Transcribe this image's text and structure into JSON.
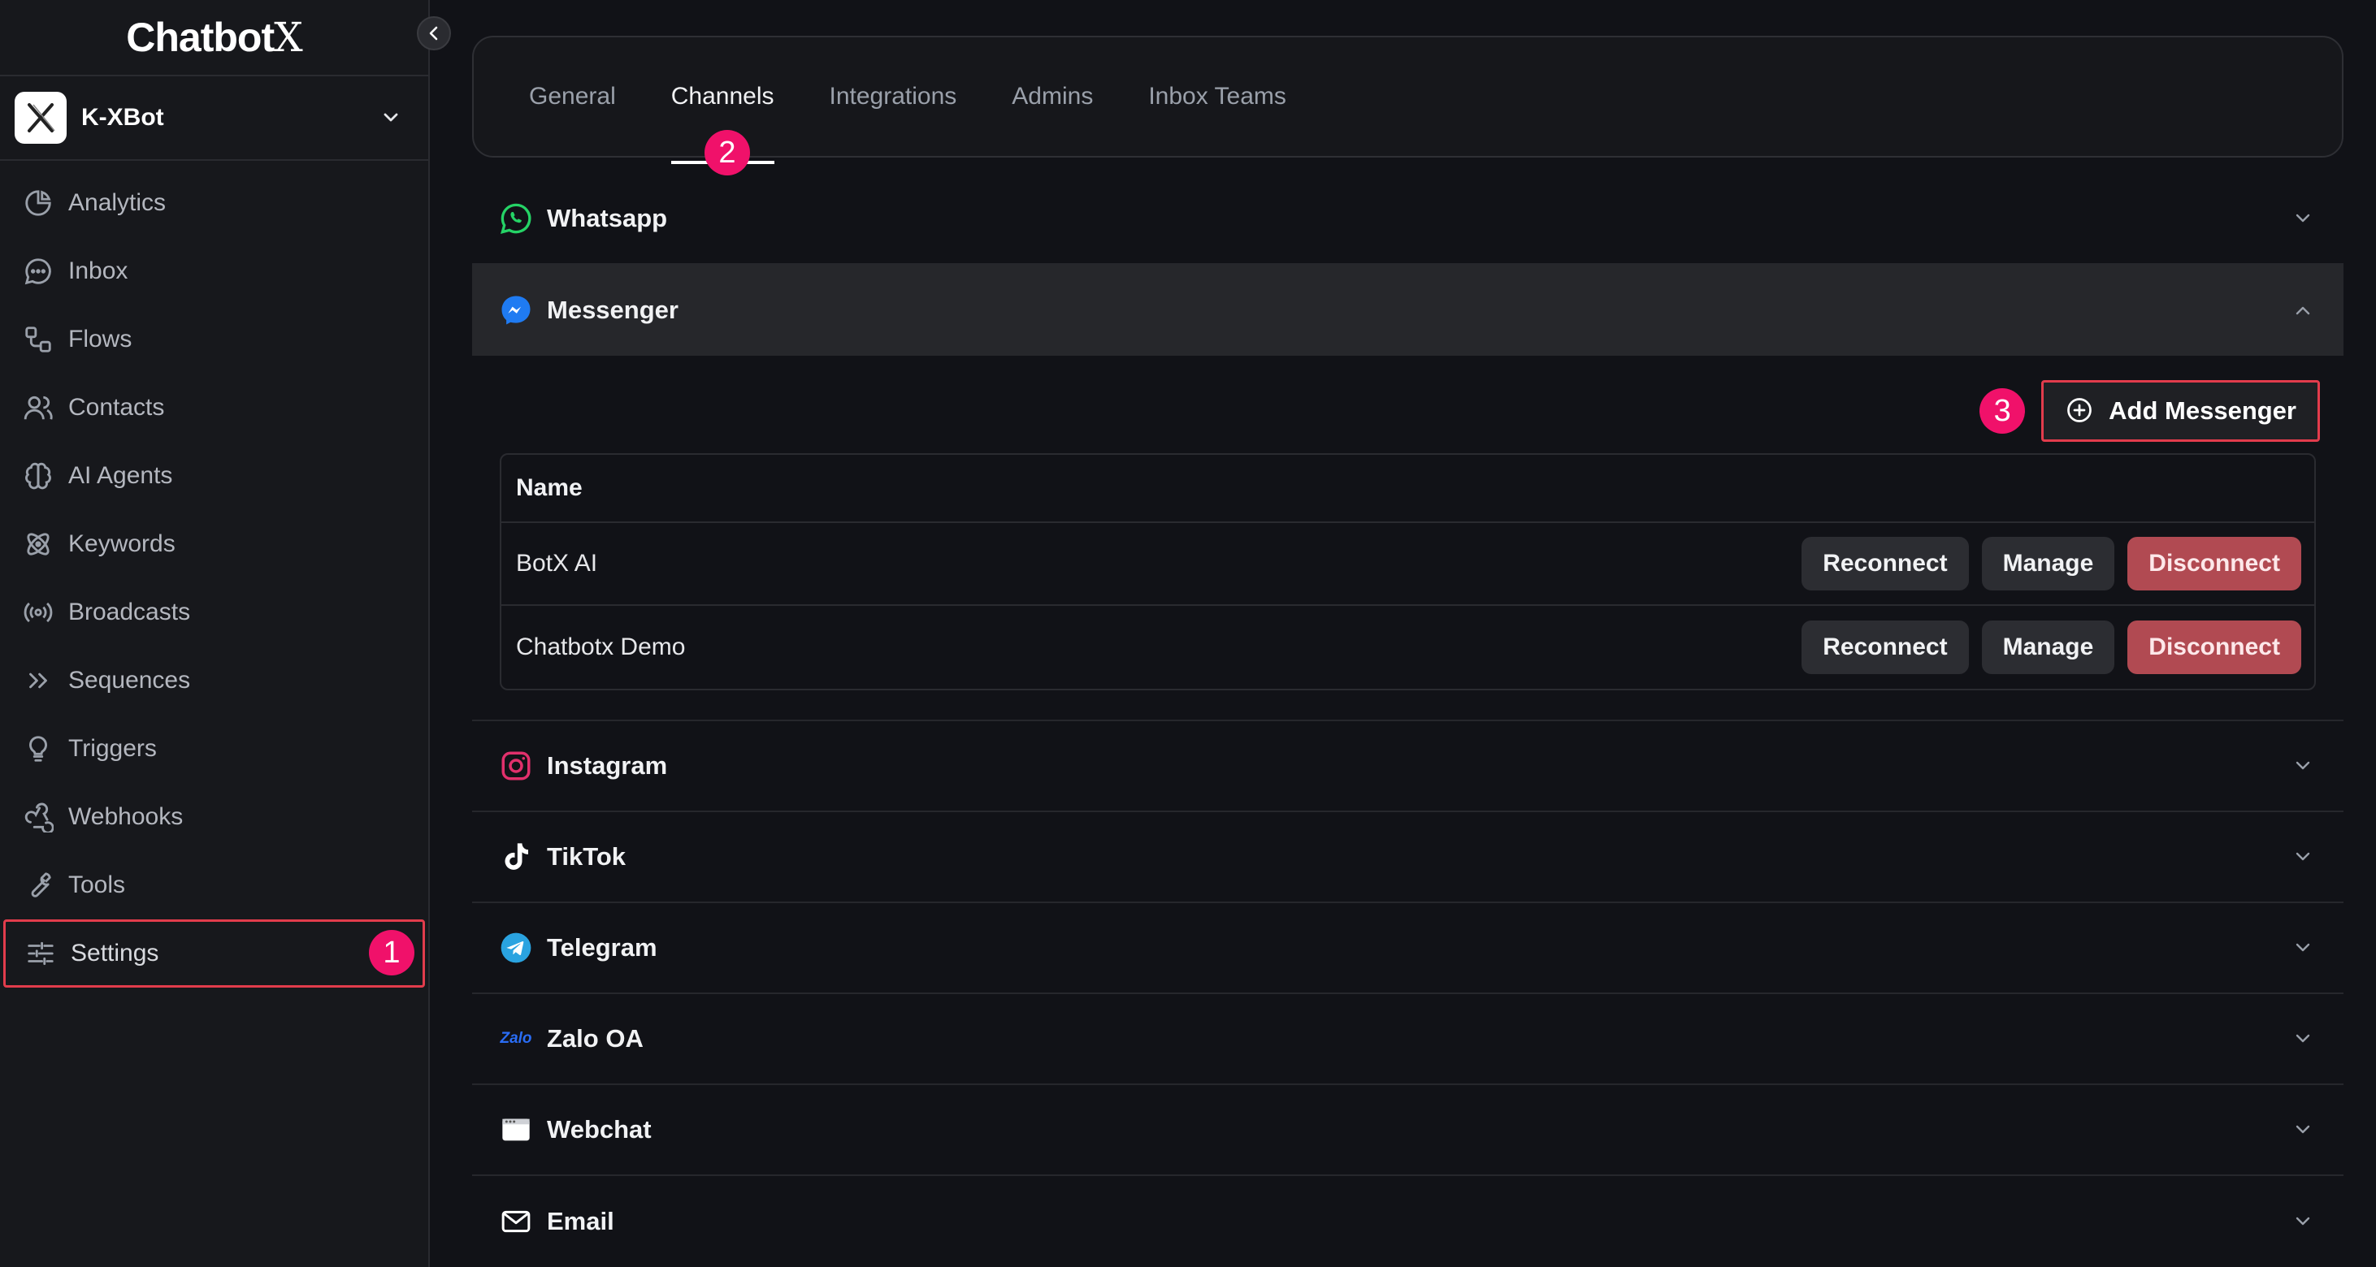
{
  "brand": {
    "name": "Chatbot",
    "name_x": "X"
  },
  "bot": {
    "name": "K-XBot"
  },
  "sidebar": {
    "items": [
      {
        "label": "Analytics",
        "icon": "pie-chart-icon"
      },
      {
        "label": "Inbox",
        "icon": "chat-bubble-icon"
      },
      {
        "label": "Flows",
        "icon": "flow-icon"
      },
      {
        "label": "Contacts",
        "icon": "users-icon"
      },
      {
        "label": "AI Agents",
        "icon": "brain-icon"
      },
      {
        "label": "Keywords",
        "icon": "atom-icon"
      },
      {
        "label": "Broadcasts",
        "icon": "broadcast-icon"
      },
      {
        "label": "Sequences",
        "icon": "chevrons-right-icon"
      },
      {
        "label": "Triggers",
        "icon": "lightbulb-icon"
      },
      {
        "label": "Webhooks",
        "icon": "webhook-icon"
      },
      {
        "label": "Tools",
        "icon": "wrench-icon"
      },
      {
        "label": "Settings",
        "icon": "sliders-icon"
      }
    ]
  },
  "annotations": {
    "one": "1",
    "two": "2",
    "three": "3"
  },
  "tabs": [
    "General",
    "Channels",
    "Integrations",
    "Admins",
    "Inbox Teams"
  ],
  "channels": {
    "whatsapp": "Whatsapp",
    "messenger": "Messenger",
    "instagram": "Instagram",
    "tiktok": "TikTok",
    "telegram": "Telegram",
    "zalo": "Zalo OA",
    "zalo_logo": "Zalo",
    "webchat": "Webchat",
    "email": "Email"
  },
  "messenger_panel": {
    "add_label": "Add Messenger",
    "column_name": "Name",
    "rows": [
      {
        "name": "BotX AI",
        "reconnect": "Reconnect",
        "manage": "Manage",
        "disconnect": "Disconnect"
      },
      {
        "name": "Chatbotx Demo",
        "reconnect": "Reconnect",
        "manage": "Manage",
        "disconnect": "Disconnect"
      }
    ]
  },
  "colors": {
    "accent_badge": "#f0116a",
    "highlight_border": "#e23c4c",
    "danger": "#b14a52"
  }
}
